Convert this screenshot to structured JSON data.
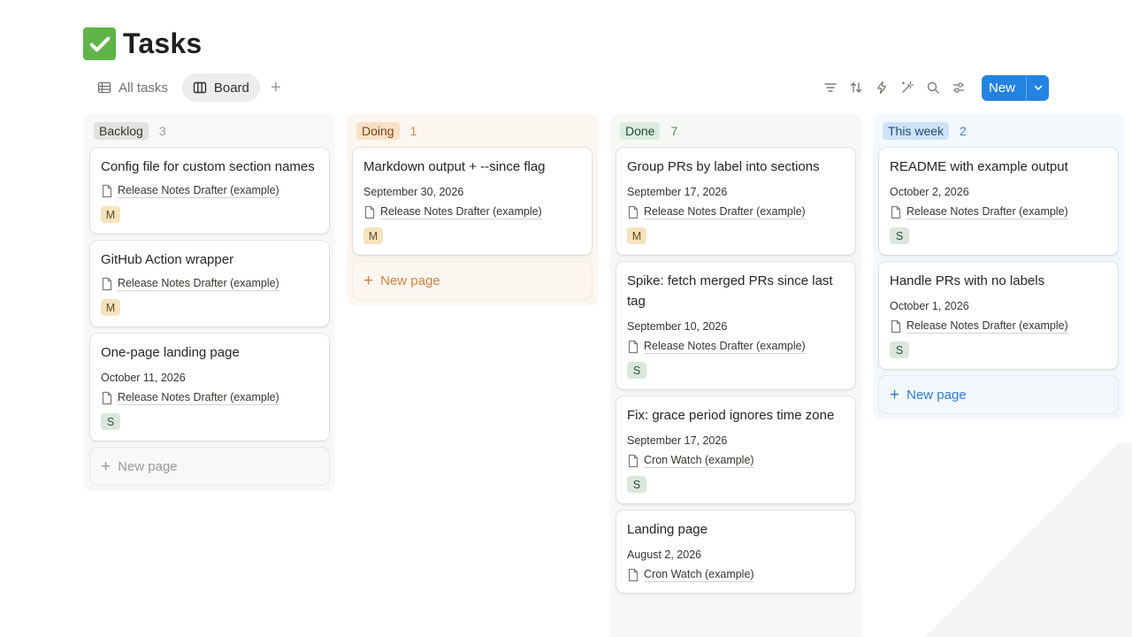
{
  "page": {
    "title": "Tasks"
  },
  "views": [
    {
      "label": "All tasks",
      "icon": "table-icon"
    },
    {
      "label": "Board",
      "icon": "board-icon"
    }
  ],
  "add_view_label": "+",
  "toolbar": {
    "icons": [
      "filter-icon",
      "sort-icon",
      "automation-icon",
      "ai-icon",
      "search-icon",
      "settings-icon"
    ],
    "new_label": "New"
  },
  "new_page_label": "New page",
  "columns": [
    {
      "name": "Backlog",
      "count": "3",
      "cards": [
        {
          "title": "Config file for custom section names",
          "date": "",
          "project": "Release Notes Drafter (example)",
          "assignee": "M"
        },
        {
          "title": "GitHub Action wrapper",
          "date": "",
          "project": "Release Notes Drafter (example)",
          "assignee": "M"
        },
        {
          "title": "One-page landing page",
          "date": "October 11, 2026",
          "project": "Release Notes Drafter (example)",
          "assignee": "S"
        }
      ]
    },
    {
      "name": "Doing",
      "count": "1",
      "cards": [
        {
          "title": "Markdown output + --since flag",
          "date": "September 30, 2026",
          "project": "Release Notes Drafter (example)",
          "assignee": "M"
        }
      ]
    },
    {
      "name": "Done",
      "count": "7",
      "cards": [
        {
          "title": "Group PRs by label into sections",
          "date": "September 17, 2026",
          "project": "Release Notes Drafter (example)",
          "assignee": "M"
        },
        {
          "title": "Spike: fetch merged PRs since last tag",
          "date": "September 10, 2026",
          "project": "Release Notes Drafter (example)",
          "assignee": "S"
        },
        {
          "title": "Fix: grace period ignores time zone",
          "date": "September 17, 2026",
          "project": "Cron Watch (example)",
          "assignee": "S"
        },
        {
          "title": "Landing page",
          "date": "August 2, 2026",
          "project": "Cron Watch (example)",
          "assignee": ""
        }
      ]
    },
    {
      "name": "This week",
      "count": "2",
      "cards": [
        {
          "title": "README with example output",
          "date": "October 2, 2026",
          "project": "Release Notes Drafter (example)",
          "assignee": "S"
        },
        {
          "title": "Handle PRs with no labels",
          "date": "October 1, 2026",
          "project": "Release Notes Drafter (example)",
          "assignee": "S"
        }
      ]
    }
  ]
}
